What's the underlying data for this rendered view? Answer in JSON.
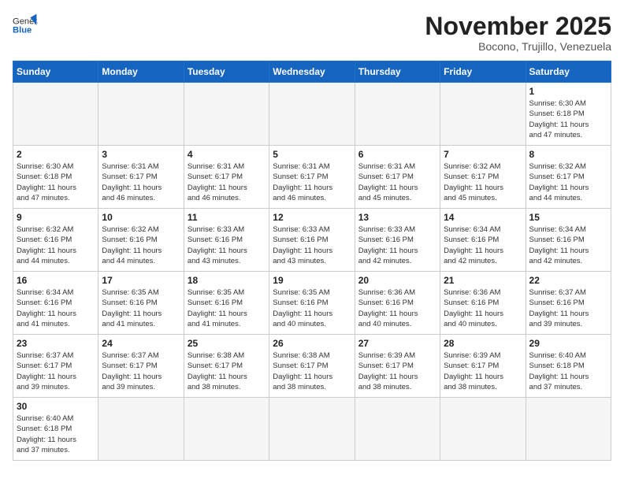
{
  "header": {
    "logo_general": "General",
    "logo_blue": "Blue",
    "month_title": "November 2025",
    "location": "Bocono, Trujillo, Venezuela"
  },
  "weekdays": [
    "Sunday",
    "Monday",
    "Tuesday",
    "Wednesday",
    "Thursday",
    "Friday",
    "Saturday"
  ],
  "weeks": [
    [
      {
        "day": "",
        "info": ""
      },
      {
        "day": "",
        "info": ""
      },
      {
        "day": "",
        "info": ""
      },
      {
        "day": "",
        "info": ""
      },
      {
        "day": "",
        "info": ""
      },
      {
        "day": "",
        "info": ""
      },
      {
        "day": "1",
        "info": "Sunrise: 6:30 AM\nSunset: 6:18 PM\nDaylight: 11 hours\nand 47 minutes."
      }
    ],
    [
      {
        "day": "2",
        "info": "Sunrise: 6:30 AM\nSunset: 6:18 PM\nDaylight: 11 hours\nand 47 minutes."
      },
      {
        "day": "3",
        "info": "Sunrise: 6:31 AM\nSunset: 6:17 PM\nDaylight: 11 hours\nand 46 minutes."
      },
      {
        "day": "4",
        "info": "Sunrise: 6:31 AM\nSunset: 6:17 PM\nDaylight: 11 hours\nand 46 minutes."
      },
      {
        "day": "5",
        "info": "Sunrise: 6:31 AM\nSunset: 6:17 PM\nDaylight: 11 hours\nand 46 minutes."
      },
      {
        "day": "6",
        "info": "Sunrise: 6:31 AM\nSunset: 6:17 PM\nDaylight: 11 hours\nand 45 minutes."
      },
      {
        "day": "7",
        "info": "Sunrise: 6:32 AM\nSunset: 6:17 PM\nDaylight: 11 hours\nand 45 minutes."
      },
      {
        "day": "8",
        "info": "Sunrise: 6:32 AM\nSunset: 6:17 PM\nDaylight: 11 hours\nand 44 minutes."
      }
    ],
    [
      {
        "day": "9",
        "info": "Sunrise: 6:32 AM\nSunset: 6:16 PM\nDaylight: 11 hours\nand 44 minutes."
      },
      {
        "day": "10",
        "info": "Sunrise: 6:32 AM\nSunset: 6:16 PM\nDaylight: 11 hours\nand 44 minutes."
      },
      {
        "day": "11",
        "info": "Sunrise: 6:33 AM\nSunset: 6:16 PM\nDaylight: 11 hours\nand 43 minutes."
      },
      {
        "day": "12",
        "info": "Sunrise: 6:33 AM\nSunset: 6:16 PM\nDaylight: 11 hours\nand 43 minutes."
      },
      {
        "day": "13",
        "info": "Sunrise: 6:33 AM\nSunset: 6:16 PM\nDaylight: 11 hours\nand 42 minutes."
      },
      {
        "day": "14",
        "info": "Sunrise: 6:34 AM\nSunset: 6:16 PM\nDaylight: 11 hours\nand 42 minutes."
      },
      {
        "day": "15",
        "info": "Sunrise: 6:34 AM\nSunset: 6:16 PM\nDaylight: 11 hours\nand 42 minutes."
      }
    ],
    [
      {
        "day": "16",
        "info": "Sunrise: 6:34 AM\nSunset: 6:16 PM\nDaylight: 11 hours\nand 41 minutes."
      },
      {
        "day": "17",
        "info": "Sunrise: 6:35 AM\nSunset: 6:16 PM\nDaylight: 11 hours\nand 41 minutes."
      },
      {
        "day": "18",
        "info": "Sunrise: 6:35 AM\nSunset: 6:16 PM\nDaylight: 11 hours\nand 41 minutes."
      },
      {
        "day": "19",
        "info": "Sunrise: 6:35 AM\nSunset: 6:16 PM\nDaylight: 11 hours\nand 40 minutes."
      },
      {
        "day": "20",
        "info": "Sunrise: 6:36 AM\nSunset: 6:16 PM\nDaylight: 11 hours\nand 40 minutes."
      },
      {
        "day": "21",
        "info": "Sunrise: 6:36 AM\nSunset: 6:16 PM\nDaylight: 11 hours\nand 40 minutes."
      },
      {
        "day": "22",
        "info": "Sunrise: 6:37 AM\nSunset: 6:16 PM\nDaylight: 11 hours\nand 39 minutes."
      }
    ],
    [
      {
        "day": "23",
        "info": "Sunrise: 6:37 AM\nSunset: 6:17 PM\nDaylight: 11 hours\nand 39 minutes."
      },
      {
        "day": "24",
        "info": "Sunrise: 6:37 AM\nSunset: 6:17 PM\nDaylight: 11 hours\nand 39 minutes."
      },
      {
        "day": "25",
        "info": "Sunrise: 6:38 AM\nSunset: 6:17 PM\nDaylight: 11 hours\nand 38 minutes."
      },
      {
        "day": "26",
        "info": "Sunrise: 6:38 AM\nSunset: 6:17 PM\nDaylight: 11 hours\nand 38 minutes."
      },
      {
        "day": "27",
        "info": "Sunrise: 6:39 AM\nSunset: 6:17 PM\nDaylight: 11 hours\nand 38 minutes."
      },
      {
        "day": "28",
        "info": "Sunrise: 6:39 AM\nSunset: 6:17 PM\nDaylight: 11 hours\nand 38 minutes."
      },
      {
        "day": "29",
        "info": "Sunrise: 6:40 AM\nSunset: 6:18 PM\nDaylight: 11 hours\nand 37 minutes."
      }
    ],
    [
      {
        "day": "30",
        "info": "Sunrise: 6:40 AM\nSunset: 6:18 PM\nDaylight: 11 hours\nand 37 minutes."
      },
      {
        "day": "",
        "info": ""
      },
      {
        "day": "",
        "info": ""
      },
      {
        "day": "",
        "info": ""
      },
      {
        "day": "",
        "info": ""
      },
      {
        "day": "",
        "info": ""
      },
      {
        "day": "",
        "info": ""
      }
    ]
  ]
}
